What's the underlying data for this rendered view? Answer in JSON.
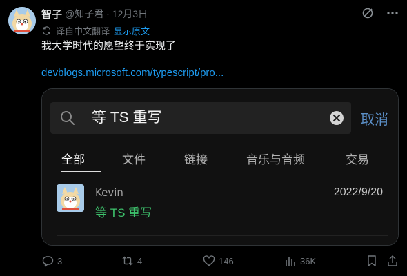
{
  "author": {
    "name": "智子",
    "meta": "@知子君 · 12月3日"
  },
  "translation": {
    "label": "译自中文翻译",
    "show_original": "显示原文"
  },
  "tweet": {
    "text": "我大学时代的愿望终于实现了",
    "link": "devblogs.microsoft.com/typescript/pro..."
  },
  "card": {
    "search": {
      "value": "等 TS 重写",
      "cancel_label": "取消"
    },
    "tabs": [
      {
        "label": "全部",
        "active": true
      },
      {
        "label": "文件"
      },
      {
        "label": "链接"
      },
      {
        "label": "音乐与音频"
      },
      {
        "label": "交易"
      }
    ],
    "result": {
      "name": "Kevin",
      "date": "2022/9/20",
      "snippet": "等 TS 重写"
    }
  },
  "actions": {
    "replies": "3",
    "reposts": "4",
    "likes": "146",
    "views": "36K"
  },
  "colors": {
    "accent": "#1d9bf0",
    "highlight": "#3ec46d",
    "cancel": "#5b8fc7"
  }
}
